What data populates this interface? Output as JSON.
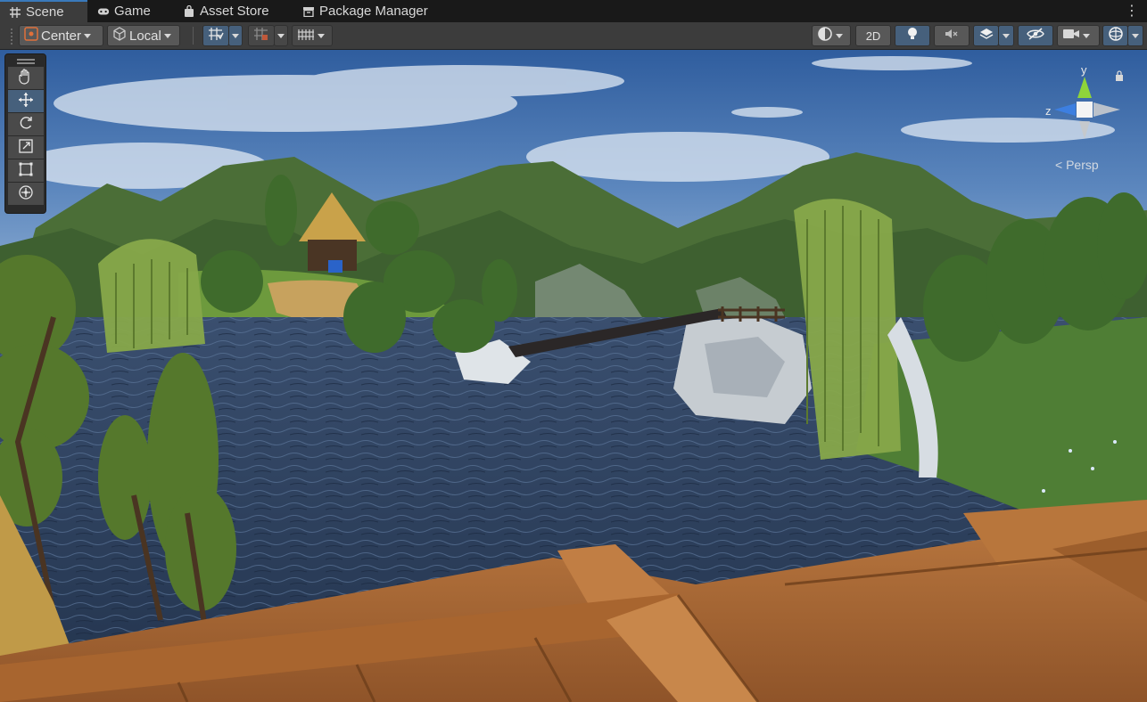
{
  "tabs": [
    {
      "label": "Scene",
      "icon": "grid-icon"
    },
    {
      "label": "Game",
      "icon": "gamepad-icon"
    },
    {
      "label": "Asset Store",
      "icon": "shopping-bag-icon"
    },
    {
      "label": "Package Manager",
      "icon": "package-icon"
    }
  ],
  "toolbar": {
    "pivot_label": "Center",
    "space_label": "Local",
    "mode_2d_label": "2D"
  },
  "gizmo": {
    "y_axis_label": "y",
    "z_axis_label": "z",
    "projection_label": "Persp"
  },
  "colors": {
    "accent": "#46607c",
    "tab_highlight": "#3a79bb",
    "toolbar_bg": "#3c3c3c",
    "y_axis": "#8fd43a",
    "z_axis": "#3d7fe0"
  }
}
